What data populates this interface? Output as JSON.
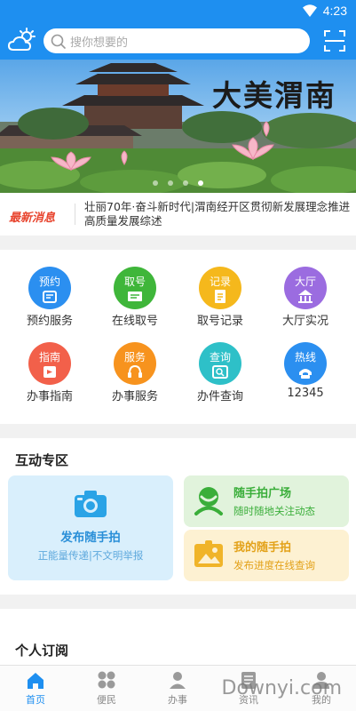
{
  "status_bar": {
    "time": "4:23"
  },
  "header": {
    "search_placeholder": "搜你想要的"
  },
  "banner": {
    "calligraphy": "大美渭南",
    "slide_count": 4,
    "active_slide": 4
  },
  "news": {
    "tag": "最新消息",
    "headline": "壮丽70年·奋斗新时代|渭南经开区贯彻新发展理念推进高质量发展综述"
  },
  "services": [
    {
      "badge": "预约",
      "label": "预约服务",
      "color": "#2b8ff0",
      "icon": "calendar-icon"
    },
    {
      "badge": "取号",
      "label": "在线取号",
      "color": "#3fb63a",
      "icon": "ticket-icon"
    },
    {
      "badge": "记录",
      "label": "取号记录",
      "color": "#f5b81c",
      "icon": "record-icon"
    },
    {
      "badge": "大厅",
      "label": "大厅实况",
      "color": "#9b6ce0",
      "icon": "building-icon"
    },
    {
      "badge": "指南",
      "label": "办事指南",
      "color": "#f2604a",
      "icon": "guide-icon"
    },
    {
      "badge": "服务",
      "label": "办事服务",
      "color": "#f7931e",
      "icon": "headset-icon"
    },
    {
      "badge": "查询",
      "label": "办件查询",
      "color": "#2ec0c8",
      "icon": "query-icon"
    },
    {
      "badge": "热线",
      "label": "12345",
      "color": "#2b8ff0",
      "icon": "phone-icon"
    }
  ],
  "interaction": {
    "title": "互动专区",
    "publish": {
      "title": "发布随手拍",
      "subtitle": "正能量传递|不文明举报"
    },
    "square": {
      "title": "随手拍广场",
      "subtitle": "随时随地关注动态",
      "color": "#3aae3a",
      "bg": "#e1f3dc"
    },
    "mine": {
      "title": "我的随手拍",
      "subtitle": "发布进度在线查询",
      "color": "#e3a21a",
      "bg": "#fdf1d2"
    }
  },
  "subscription": {
    "title": "个人订阅"
  },
  "tabbar": [
    {
      "label": "首页",
      "icon": "home-icon",
      "active": true
    },
    {
      "label": "便民",
      "icon": "grid-icon",
      "active": false
    },
    {
      "label": "办事",
      "icon": "person-icon",
      "active": false
    },
    {
      "label": "资讯",
      "icon": "news-icon",
      "active": false
    },
    {
      "label": "我的",
      "icon": "user-icon",
      "active": false
    }
  ],
  "watermark": "Downyi.com"
}
